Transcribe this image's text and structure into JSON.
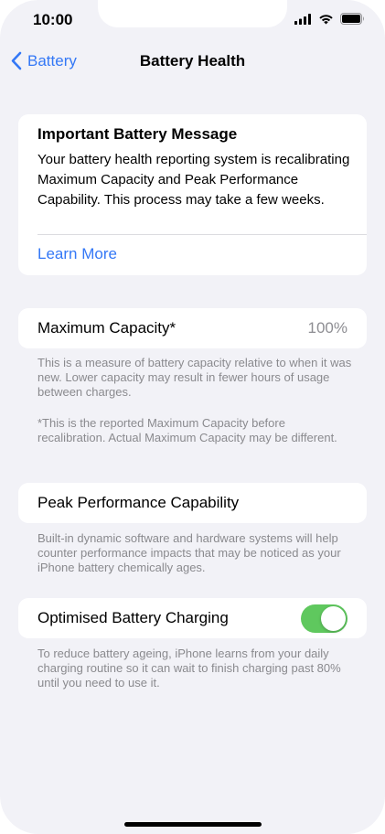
{
  "status_bar": {
    "time": "10:00",
    "icons": [
      "cellular-signal-icon",
      "wifi-icon",
      "battery-icon"
    ]
  },
  "nav": {
    "back_label": "Battery",
    "title": "Battery Health"
  },
  "message_card": {
    "title": "Important Battery Message",
    "body": "Your battery health reporting system is recalibrating Maximum Capacity and Peak Performance Capability. This process may take a few weeks.",
    "link": "Learn More"
  },
  "max_capacity": {
    "label": "Maximum Capacity*",
    "value": "100%",
    "footnote_1": "This is a measure of battery capacity relative to when it was new. Lower capacity may result in fewer hours of usage between charges.",
    "footnote_2": "*This is the reported Maximum Capacity before recalibration. Actual Maximum Capacity may be different."
  },
  "peak_performance": {
    "label": "Peak Performance Capability",
    "footnote": "Built-in dynamic software and hardware systems will help counter performance impacts that may be noticed as your iPhone battery chemically ages."
  },
  "optimised_charging": {
    "label": "Optimised Battery Charging",
    "enabled": true,
    "footnote": "To reduce battery ageing, iPhone learns from your daily charging routine so it can wait to finish charging past 80% until you need to use it."
  },
  "colors": {
    "accent": "#3478f6",
    "toggle_on": "#5fc85e",
    "background": "#f2f2f7",
    "secondary_text": "#8a8a8e"
  }
}
